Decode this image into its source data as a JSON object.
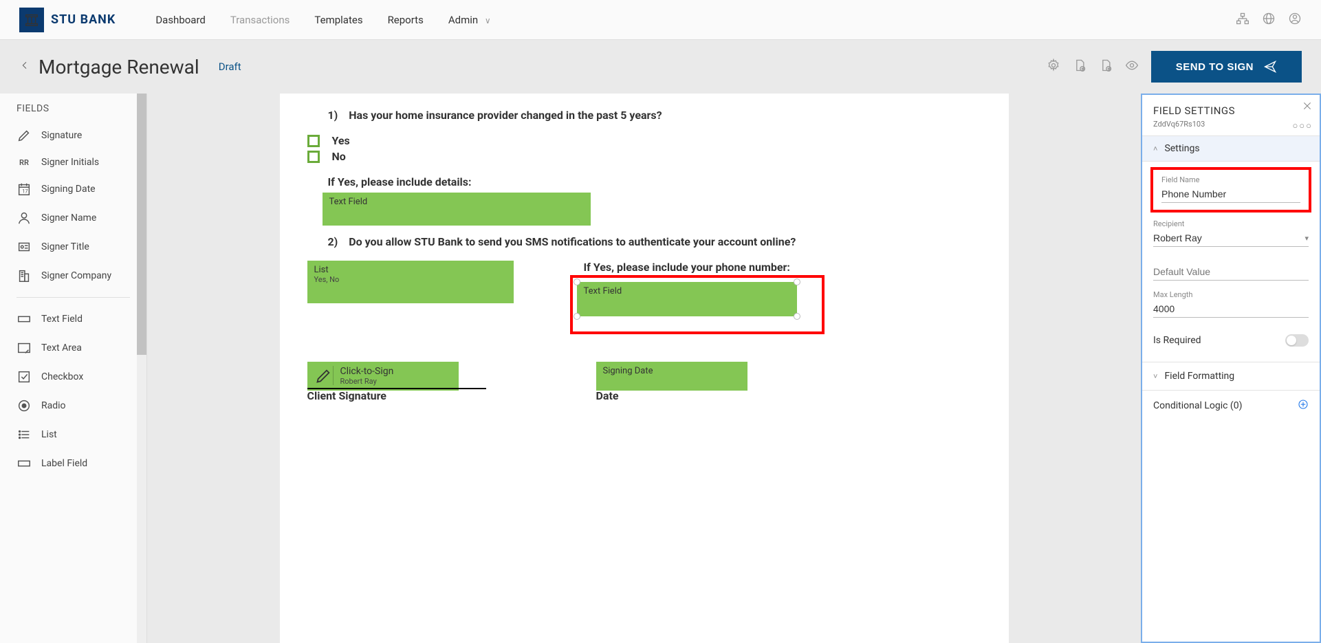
{
  "brand": {
    "name": "STU BANK"
  },
  "nav": {
    "dashboard": "Dashboard",
    "transactions": "Transactions",
    "templates": "Templates",
    "reports": "Reports",
    "admin": "Admin"
  },
  "page": {
    "title": "Mortgage Renewal",
    "status": "Draft",
    "send_btn": "SEND TO SIGN"
  },
  "palette": {
    "heading": "FIELDS",
    "items": {
      "signature": "Signature",
      "initials": "Signer Initials",
      "signing_date": "Signing Date",
      "signer_name": "Signer Name",
      "signer_title": "Signer Title",
      "signer_company": "Signer Company",
      "text_field": "Text Field",
      "text_area": "Text Area",
      "checkbox": "Checkbox",
      "radio": "Radio",
      "list": "List",
      "label_field": "Label Field"
    },
    "initials_abbr": "RR"
  },
  "doc": {
    "q1_num": "1)",
    "q1": "Has your home insurance provider changed in the past 5 years?",
    "opt_yes": "Yes",
    "opt_no": "No",
    "q1_sub": "If Yes, please include details:",
    "text_field_label": "Text Field",
    "q2_num": "2)",
    "q2": "Do you allow STU Bank to send you SMS notifications to authenticate your account online?",
    "list_label": "List",
    "list_sub": "Yes, No",
    "q2_sub": "If Yes, please include your phone number:",
    "phone_field_label": "Text Field",
    "click_to_sign": "Click-to-Sign",
    "signer_name_sub": "Robert Ray",
    "signing_date": "Signing Date",
    "client_sig_label": "Client Signature",
    "date_label": "Date"
  },
  "settings": {
    "panel_title": "FIELD SETTINGS",
    "field_id": "ZddVq67Rs103",
    "section_settings": "Settings",
    "field_name_label": "Field Name",
    "field_name_value": "Phone Number",
    "recipient_label": "Recipient",
    "recipient_value": "Robert Ray",
    "default_value_placeholder": "Default Value",
    "max_length_label": "Max Length",
    "max_length_value": "4000",
    "is_required_label": "Is Required",
    "field_formatting": "Field Formatting",
    "conditional_logic": "Conditional Logic (0)"
  }
}
